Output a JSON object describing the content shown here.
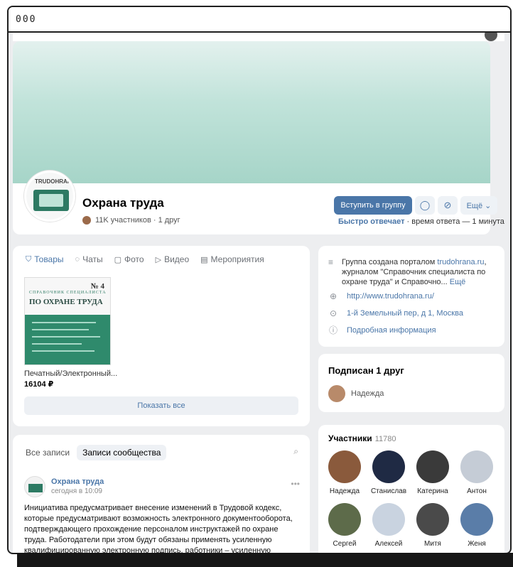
{
  "window": {
    "title": "000"
  },
  "group": {
    "title": "Охрана труда",
    "avatar_logo": "TRUDOHRANA.",
    "meta": "11K участников · 1 друг",
    "join_label": "Вступить в группу",
    "more_label": "Ещё",
    "response_fast": "Быстро отвечает",
    "response_time": " · время ответа — 1 минута"
  },
  "tabs": [
    {
      "label": "Товары",
      "icon": "bag-icon"
    },
    {
      "label": "Чаты",
      "icon": "chat-icon"
    },
    {
      "label": "Фото",
      "icon": "photo-icon"
    },
    {
      "label": "Видео",
      "icon": "video-icon"
    },
    {
      "label": "Мероприятия",
      "icon": "calendar-icon"
    }
  ],
  "product": {
    "cover_number": "№ 4",
    "cover_subtitle": "СПРАВОЧНИК СПЕЦИАЛИСТА",
    "cover_title": "ПО ОХРАНЕ ТРУДА",
    "name": "Печатный/Электронный...",
    "price": "16104 ₽",
    "show_all": "Показать все"
  },
  "info": {
    "description_prefix": "Группа создана порталом ",
    "description_link": "trudohrana.ru",
    "description_rest": ", журналом \"Справочник специалиста по охране труда\" и Справочно...",
    "description_more": "Ещё",
    "website": "http://www.trudohrana.ru/",
    "address": "1-й Земельный пер, д 1, Москва",
    "details": "Подробная информация"
  },
  "subscribed": {
    "title": "Подписан 1 друг",
    "friend": "Надежда"
  },
  "members": {
    "title": "Участники",
    "count": "11780",
    "list": [
      {
        "name": "Надежда",
        "color": "#8a5a3c"
      },
      {
        "name": "Станислав",
        "color": "#1f2a44"
      },
      {
        "name": "Катерина",
        "color": "#3a3a3a"
      },
      {
        "name": "Антон",
        "color": "#c5ccd6"
      },
      {
        "name": "Сергей",
        "color": "#5d6b4a"
      },
      {
        "name": "Алексей",
        "color": "#c9d3e0"
      },
      {
        "name": "Митя",
        "color": "#4a4a4a"
      },
      {
        "name": "Женя",
        "color": "#5a7da8"
      }
    ]
  },
  "wall": {
    "tab_all": "Все записи",
    "tab_community": "Записи сообщества",
    "post_author": "Охрана труда",
    "post_time": "сегодня в 10:09",
    "post_text": "Инициатива предусматривает внесение изменений в Трудовой кодекс, которые предусматривают возможность электронного документооборота, подтверждающего прохождение персоналом инструктажей по охране труда. Работодатели при этом будут обязаны применять усиленную квалифицированную электронную подпись, работники – усиленную"
  }
}
